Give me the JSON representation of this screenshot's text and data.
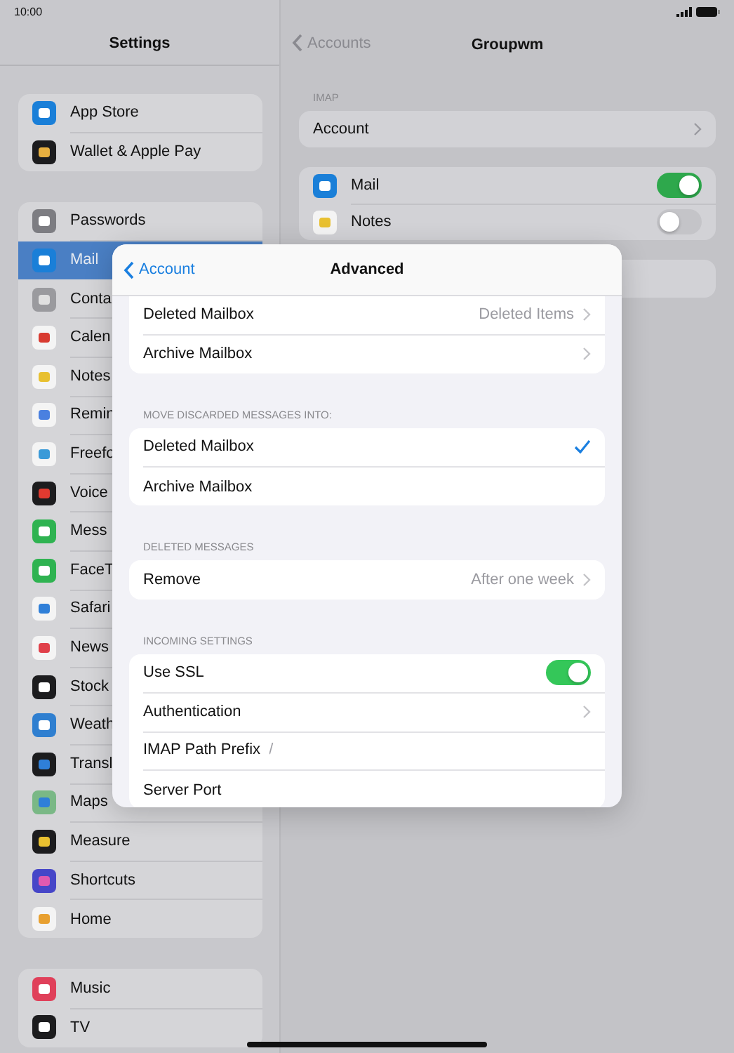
{
  "status_bar": {
    "time": "10:00"
  },
  "sidebar": {
    "title": "Settings",
    "groups": [
      [
        {
          "label": "App Store",
          "selected": false
        },
        {
          "label": "Wallet & Apple Pay",
          "selected": false
        }
      ],
      [
        {
          "label": "Passwords",
          "selected": false
        },
        {
          "label": "Mail",
          "selected": true
        },
        {
          "label": "Conta",
          "selected": false
        },
        {
          "label": "Calen",
          "selected": false
        },
        {
          "label": "Notes",
          "selected": false
        },
        {
          "label": "Remin",
          "selected": false
        },
        {
          "label": "Freefo",
          "selected": false
        },
        {
          "label": "Voice",
          "selected": false
        },
        {
          "label": "Mess",
          "selected": false
        },
        {
          "label": "FaceT",
          "selected": false
        },
        {
          "label": "Safari",
          "selected": false
        },
        {
          "label": "News",
          "selected": false
        },
        {
          "label": "Stock",
          "selected": false
        },
        {
          "label": "Weath",
          "selected": false
        },
        {
          "label": "Transl",
          "selected": false
        },
        {
          "label": "Maps",
          "selected": false
        },
        {
          "label": "Measure",
          "selected": false
        },
        {
          "label": "Shortcuts",
          "selected": false
        },
        {
          "label": "Home",
          "selected": false
        }
      ],
      [
        {
          "label": "Music",
          "selected": false
        },
        {
          "label": "TV",
          "selected": false
        }
      ]
    ]
  },
  "detail": {
    "back": "Accounts",
    "title": "Groupwm",
    "sections": [
      {
        "header": "IMAP",
        "rows": [
          {
            "kind": "link",
            "label": "Account"
          }
        ]
      },
      {
        "rows": [
          {
            "kind": "toggle",
            "label": "Mail",
            "on": true
          },
          {
            "kind": "toggle",
            "label": "Notes",
            "on": false
          }
        ]
      }
    ]
  },
  "modal": {
    "back": "Account",
    "title": "Advanced",
    "sections": [
      {
        "rows": [
          {
            "kind": "link",
            "label": "Deleted Mailbox",
            "value": "Deleted Items"
          },
          {
            "kind": "link",
            "label": "Archive Mailbox"
          }
        ]
      },
      {
        "header": "MOVE DISCARDED MESSAGES INTO:",
        "rows": [
          {
            "kind": "choice",
            "label": "Deleted Mailbox",
            "selected": true
          },
          {
            "kind": "choice",
            "label": "Archive Mailbox",
            "selected": false
          }
        ]
      },
      {
        "header": "DELETED MESSAGES",
        "rows": [
          {
            "kind": "link",
            "label": "Remove",
            "value": "After one week"
          }
        ]
      },
      {
        "header": "INCOMING SETTINGS",
        "rows": [
          {
            "kind": "toggle",
            "label": "Use SSL",
            "on": true
          },
          {
            "kind": "link",
            "label": "Authentication"
          },
          {
            "kind": "field",
            "label": "IMAP Path Prefix",
            "value": "/"
          },
          {
            "kind": "field",
            "label": "Server Port"
          }
        ]
      }
    ]
  }
}
